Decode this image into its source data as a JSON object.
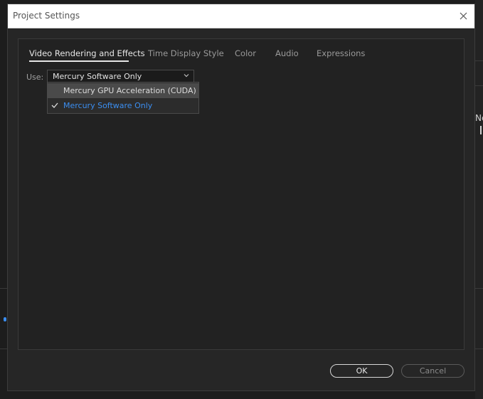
{
  "dialog": {
    "title": "Project Settings"
  },
  "tabs": [
    {
      "label": "Video Rendering and Effects",
      "active": true
    },
    {
      "label": "Time Display Style",
      "active": false
    },
    {
      "label": "Color",
      "active": false
    },
    {
      "label": "Audio",
      "active": false
    },
    {
      "label": "Expressions",
      "active": false
    }
  ],
  "renderer": {
    "label": "Use:",
    "selected": "Mercury Software Only",
    "options": [
      {
        "label": "Mercury GPU Acceleration (CUDA)",
        "checked": false,
        "hovered": true
      },
      {
        "label": "Mercury Software Only",
        "checked": true,
        "hovered": false
      }
    ]
  },
  "buttons": {
    "ok": "OK",
    "cancel": "Cancel"
  },
  "background": {
    "partial_text": "Ne"
  },
  "colors": {
    "accent_blue": "#3b8ef0",
    "hover_bg": "#4a4a4a",
    "panel_bg": "#222222"
  }
}
